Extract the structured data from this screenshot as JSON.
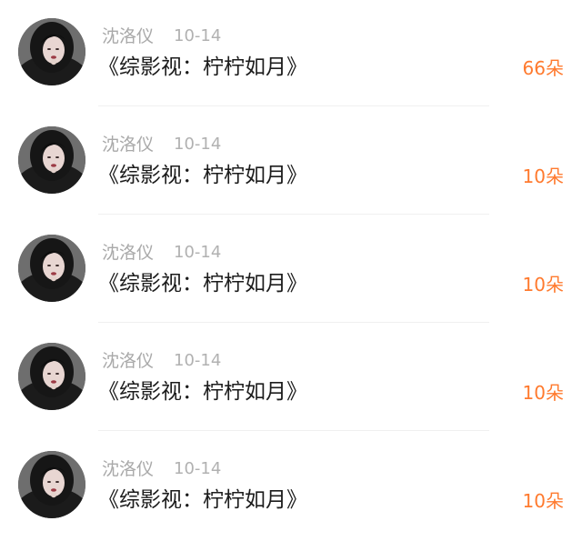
{
  "gift_list": {
    "items": [
      {
        "name": "沈洛仪",
        "date": "10-14",
        "message": "《综影视：柠柠如月》",
        "amount": "66朵",
        "avatar_icon": "user-avatar-icon"
      },
      {
        "name": "沈洛仪",
        "date": "10-14",
        "message": "《综影视：柠柠如月》",
        "amount": "10朵",
        "avatar_icon": "user-avatar-icon"
      },
      {
        "name": "沈洛仪",
        "date": "10-14",
        "message": "《综影视：柠柠如月》",
        "amount": "10朵",
        "avatar_icon": "user-avatar-icon"
      },
      {
        "name": "沈洛仪",
        "date": "10-14",
        "message": "《综影视：柠柠如月》",
        "amount": "10朵",
        "avatar_icon": "user-avatar-icon"
      },
      {
        "name": "沈洛仪",
        "date": "10-14",
        "message": "《综影视：柠柠如月》",
        "amount": "10朵",
        "avatar_icon": "user-avatar-icon"
      }
    ]
  },
  "colors": {
    "accent": "#ff7a2e",
    "name_text": "#a9a9a9",
    "message_text": "#1c1c1c",
    "divider": "#f0f0f0"
  }
}
